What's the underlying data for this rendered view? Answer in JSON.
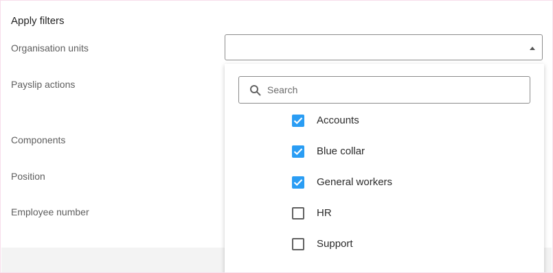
{
  "panel": {
    "title": "Apply filters",
    "filters": [
      {
        "label": "Organisation units"
      },
      {
        "label": "Payslip actions"
      },
      {
        "label": "Components"
      },
      {
        "label": "Position"
      },
      {
        "label": "Employee number"
      }
    ]
  },
  "org_units_select": {
    "value": "",
    "caret_icon": "caret-up-icon"
  },
  "dropdown": {
    "search_placeholder": "Search",
    "search_icon": "search-icon",
    "options": [
      {
        "label": "Accounts",
        "checked": true
      },
      {
        "label": "Blue collar",
        "checked": true
      },
      {
        "label": "General workers",
        "checked": true
      },
      {
        "label": "HR",
        "checked": false
      },
      {
        "label": "Support",
        "checked": false
      }
    ]
  },
  "colors": {
    "checkbox_checked": "#2a9df4",
    "checkbox_unchecked_border": "#5f5f5f",
    "footer_band": "#f3f3f3"
  }
}
